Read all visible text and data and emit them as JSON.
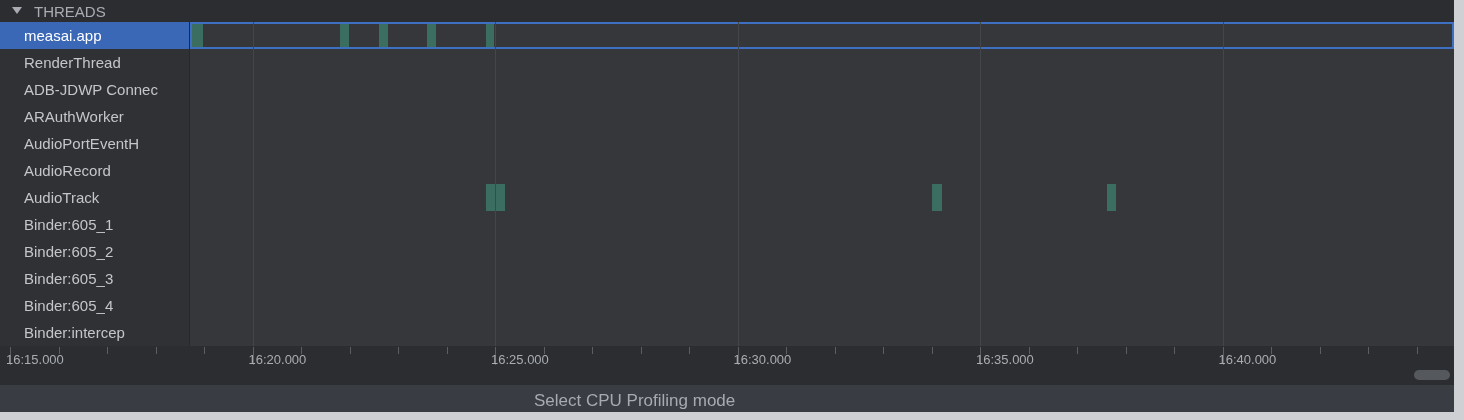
{
  "section": {
    "title": "THREADS",
    "expanded": true
  },
  "threads": [
    {
      "name": "measai.app",
      "selected": true
    },
    {
      "name": "RenderThread",
      "selected": false
    },
    {
      "name": "ADB-JDWP Connec",
      "selected": false
    },
    {
      "name": "ARAuthWorker",
      "selected": false
    },
    {
      "name": "AudioPortEventH",
      "selected": false
    },
    {
      "name": "AudioRecord",
      "selected": false
    },
    {
      "name": "AudioTrack",
      "selected": false
    },
    {
      "name": "Binder:605_1",
      "selected": false
    },
    {
      "name": "Binder:605_2",
      "selected": false
    },
    {
      "name": "Binder:605_3",
      "selected": false
    },
    {
      "name": "Binder:605_4",
      "selected": false
    },
    {
      "name": "Binder:intercep",
      "selected": false
    }
  ],
  "time_axis": {
    "ticks": [
      "16:15.000",
      "16:20.000",
      "16:25.000",
      "16:30.000",
      "16:35.000",
      "16:40.000"
    ]
  },
  "status_bar": {
    "text": "Select CPU Profiling mode"
  }
}
